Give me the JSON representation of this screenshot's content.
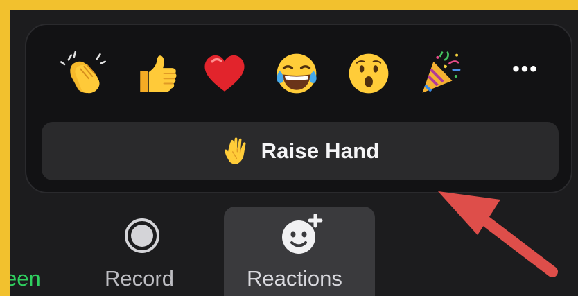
{
  "popover": {
    "reactions": [
      {
        "name": "clapping-hands",
        "glyph": "👏"
      },
      {
        "name": "thumbs-up",
        "glyph": "👍"
      },
      {
        "name": "red-heart",
        "glyph": "❤️"
      },
      {
        "name": "face-with-tears-of-joy",
        "glyph": "😂"
      },
      {
        "name": "face-with-open-mouth",
        "glyph": "😮"
      },
      {
        "name": "party-popper",
        "glyph": "🎉"
      }
    ],
    "more_label": "•••",
    "raise_hand": {
      "icon": "raised-hand-icon",
      "label": "Raise Hand"
    }
  },
  "toolbar": {
    "share_screen_label_visible": "een",
    "record_label": "Record",
    "reactions_label": "Reactions",
    "share_screen_color": "#2fcf5f"
  },
  "colors": {
    "page_background": "#f2c12e",
    "app_background": "#1c1c1e",
    "popover_background": "#121214",
    "button_background": "#2a2a2c",
    "selected_toolbar_background": "#3a3a3d",
    "annotation_arrow": "#de4e4a"
  }
}
